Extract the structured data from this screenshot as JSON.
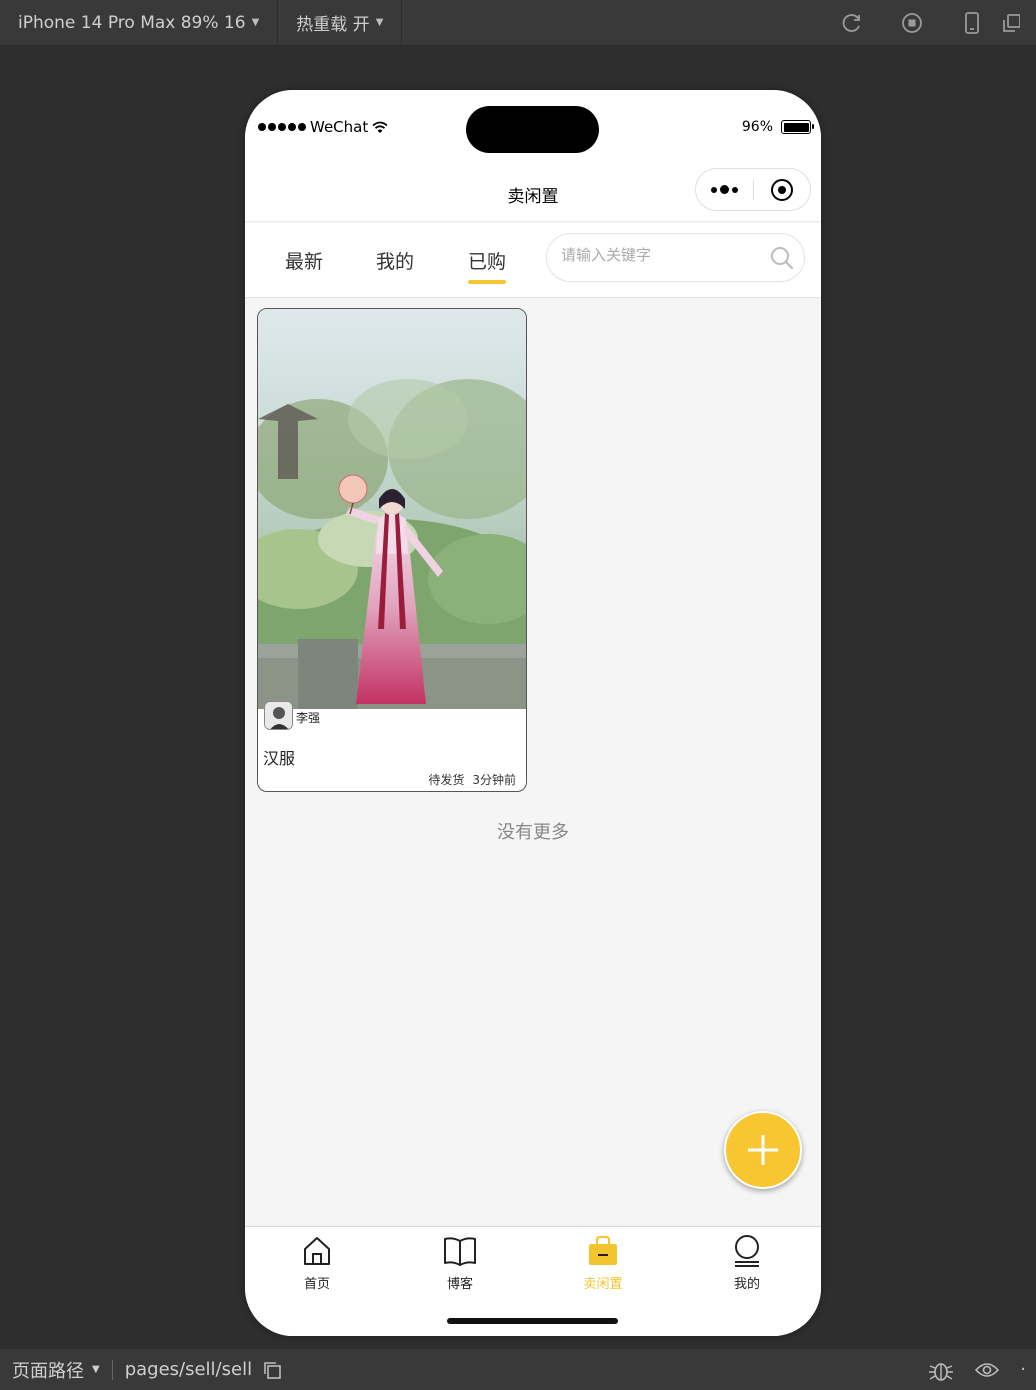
{
  "toolbar": {
    "device_label": "iPhone 14 Pro Max 89% 16",
    "hot_reload_label": "热重载 开"
  },
  "status_bar": {
    "carrier": "WeChat",
    "battery": "96%"
  },
  "navbar": {
    "title": "卖闲置"
  },
  "tabs": [
    {
      "label": "最新"
    },
    {
      "label": "我的"
    },
    {
      "label": "已购"
    }
  ],
  "active_tab": "已购",
  "search": {
    "placeholder": "请输入关键字"
  },
  "listing": {
    "user": "李强",
    "title": "汉服",
    "status": "待发货",
    "time": "3分钟前"
  },
  "no_more": "没有更多",
  "tabbar": [
    {
      "label": "首页",
      "icon": "home-icon"
    },
    {
      "label": "博客",
      "icon": "book-icon"
    },
    {
      "label": "卖闲置",
      "icon": "shopping-bag-icon"
    },
    {
      "label": "我的",
      "icon": "user-icon"
    }
  ],
  "active_tabbar": "卖闲置",
  "colors": {
    "accent": "#f7c531",
    "background": "#f5f5f5",
    "ide_background": "#2e2e2e"
  },
  "bottom_bar": {
    "path_label": "页面路径",
    "path": "pages/sell/sell"
  }
}
